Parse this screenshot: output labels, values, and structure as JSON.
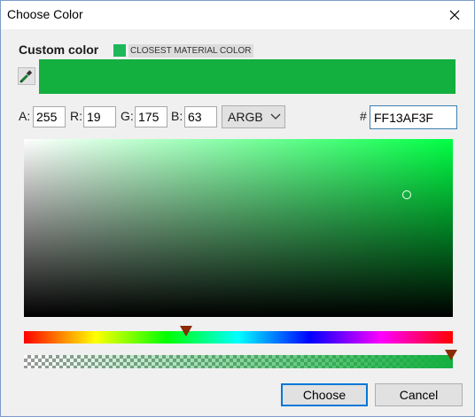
{
  "window": {
    "title": "Choose Color"
  },
  "custom_color": {
    "label": "Custom color",
    "material_label": "CLOSEST MATERIAL COLOR",
    "material_swatch_color": "#1eb85a",
    "preview_color": "#13AF3F"
  },
  "channels": {
    "a_label": "A:",
    "a_value": "255",
    "r_label": "R:",
    "r_value": "19",
    "g_label": "G:",
    "g_value": "175",
    "b_label": "B:",
    "b_value": "63"
  },
  "format": {
    "selected": "ARGB"
  },
  "hex": {
    "prefix": "#",
    "value": "FF13AF3F"
  },
  "sliders": {
    "hue_fraction": 0.38,
    "alpha_fraction": 1.0
  },
  "buttons": {
    "choose_label": "Choose",
    "cancel_label": "Cancel"
  },
  "icons": [
    "close-icon",
    "eyedropper-icon",
    "chevron-down-icon"
  ]
}
